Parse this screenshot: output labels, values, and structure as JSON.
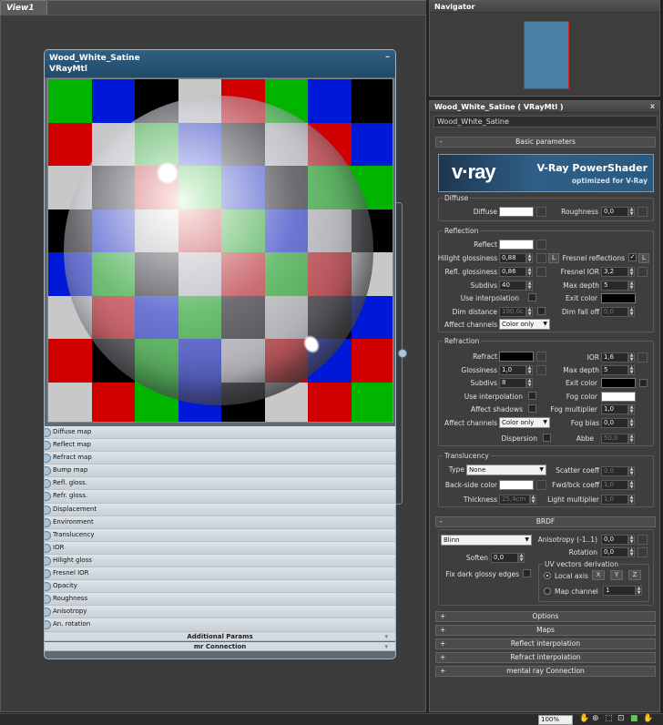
{
  "view": {
    "tab": "View1"
  },
  "node": {
    "name": "Wood_White_Satine",
    "type": "VRayMtl",
    "min_icon": "minimize-icon",
    "slots": [
      "Diffuse map",
      "Reflect map",
      "Refract map",
      "Bump map",
      "Refl. gloss.",
      "Refr. gloss.",
      "Displacement",
      "Environment",
      "Translucency",
      "IOR",
      "Hilight gloss",
      "Fresnel IOR",
      "Opacity",
      "Roughness",
      "Anisotropy",
      "An. rotation"
    ],
    "extras": [
      "Additional Params",
      "mr Connection"
    ]
  },
  "navigator": {
    "title": "Navigator"
  },
  "material": {
    "title": "Wood_White_Satine  ( VRayMtl )",
    "name": "Wood_White_Satine",
    "close": "x",
    "basic": "Basic parameters",
    "banner_logo": "v·ray",
    "banner_title": "V-Ray PowerShader",
    "banner_sub": "optimized for V-Ray",
    "diffuse": {
      "group": "Diffuse",
      "diffuse": "Diffuse",
      "roughness": "Roughness",
      "roughness_val": "0,0"
    },
    "reflection": {
      "group": "Reflection",
      "reflect": "Reflect",
      "hilight": "Hilight glossiness",
      "hilight_val": "0,88",
      "L": "L",
      "fresnel": "Fresnel reflections",
      "refl_gloss": "Refl. glossiness",
      "refl_gloss_val": "0,86",
      "fresnel_ior": "Fresnel IOR",
      "fresnel_ior_val": "3,2",
      "subdivs": "Subdivs",
      "subdivs_val": "40",
      "max_depth": "Max depth",
      "max_depth_val": "5",
      "use_interp": "Use interpolation",
      "exit_color": "Exit color",
      "dim_dist": "Dim distance",
      "dim_dist_val": "100,0c",
      "dim_falloff": "Dim fall off",
      "dim_falloff_val": "0,0",
      "affect": "Affect channels",
      "affect_val": "Color only"
    },
    "refraction": {
      "group": "Refraction",
      "refract": "Refract",
      "ior": "IOR",
      "ior_val": "1,6",
      "gloss": "Glossiness",
      "gloss_val": "1,0",
      "max_depth": "Max depth",
      "max_depth_val": "5",
      "subdivs": "Subdivs",
      "subdivs_val": "8",
      "exit_color": "Exit color",
      "use_interp": "Use interpolation",
      "fog_color": "Fog color",
      "affect_shadows": "Affect shadows",
      "fog_mult": "Fog multiplier",
      "fog_mult_val": "1,0",
      "affect": "Affect channels",
      "affect_val": "Color only",
      "fog_bias": "Fog bias",
      "fog_bias_val": "0,0",
      "dispersion": "Dispersion",
      "abbe": "Abbe",
      "abbe_val": "50,0"
    },
    "translucency": {
      "group": "Translucency",
      "type": "Type",
      "type_val": "None",
      "scatter": "Scatter coeff",
      "scatter_val": "0,0",
      "backside": "Back-side color",
      "fwd": "Fwd/bck coeff",
      "fwd_val": "1,0",
      "thickness": "Thickness",
      "thickness_val": "25,4cm",
      "light_mult": "Light multiplier",
      "light_mult_val": "1,0"
    },
    "brdf": {
      "rollout": "BRDF",
      "type_val": "Blinn",
      "aniso": "Anisotropy (-1..1)",
      "aniso_val": "0,0",
      "rotation": "Rotation",
      "rotation_val": "0,0",
      "soften": "Soften",
      "soften_val": "0,0",
      "uv": "UV vectors derivation",
      "fix": "Fix dark glossy edges",
      "local": "Local axis",
      "x": "X",
      "y": "Y",
      "z": "Z",
      "mapch": "Map channel",
      "mapch_val": "1"
    },
    "rollouts": [
      "Options",
      "Maps",
      "Reflect interpolation",
      "Refract interpolation",
      "mental ray Connection"
    ],
    "minus": "-",
    "plus": "+"
  },
  "status": {
    "zoom": "100%"
  },
  "colors": {
    "accent": "#2f5f82",
    "nav_box": "#4a7ea3",
    "nav_border": "#c9281f"
  }
}
